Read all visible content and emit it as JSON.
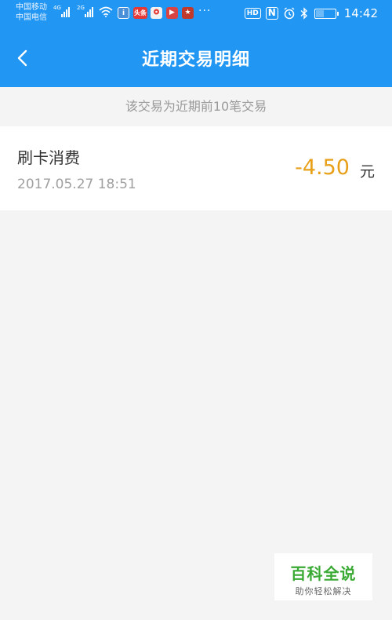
{
  "status_bar": {
    "carrier_1": "中国移动",
    "carrier_2": "中国电信",
    "sig1_tag": "4G",
    "sig2_tag": "2G",
    "app_icons": [
      "info-app-icon",
      "toutiao-app-icon",
      "maps-app-icon",
      "video-app-icon",
      "game-app-icon"
    ],
    "toutiao_label": "头条",
    "more_indicator": "···",
    "hd_label": "HD",
    "nfc_label": "N",
    "battery_level": 0.4,
    "time": "14:42"
  },
  "header": {
    "title": "近期交易明细",
    "background_color": "#2196f3"
  },
  "notice": "该交易为近期前10笔交易",
  "transactions": [
    {
      "type": "刷卡消费",
      "datetime": "2017.05.27 18:51",
      "amount": "-4.50",
      "unit": "元",
      "amount_color": "#e8a019"
    }
  ],
  "watermark": {
    "brand": "百科全说",
    "slogan": "助你轻松解决"
  }
}
